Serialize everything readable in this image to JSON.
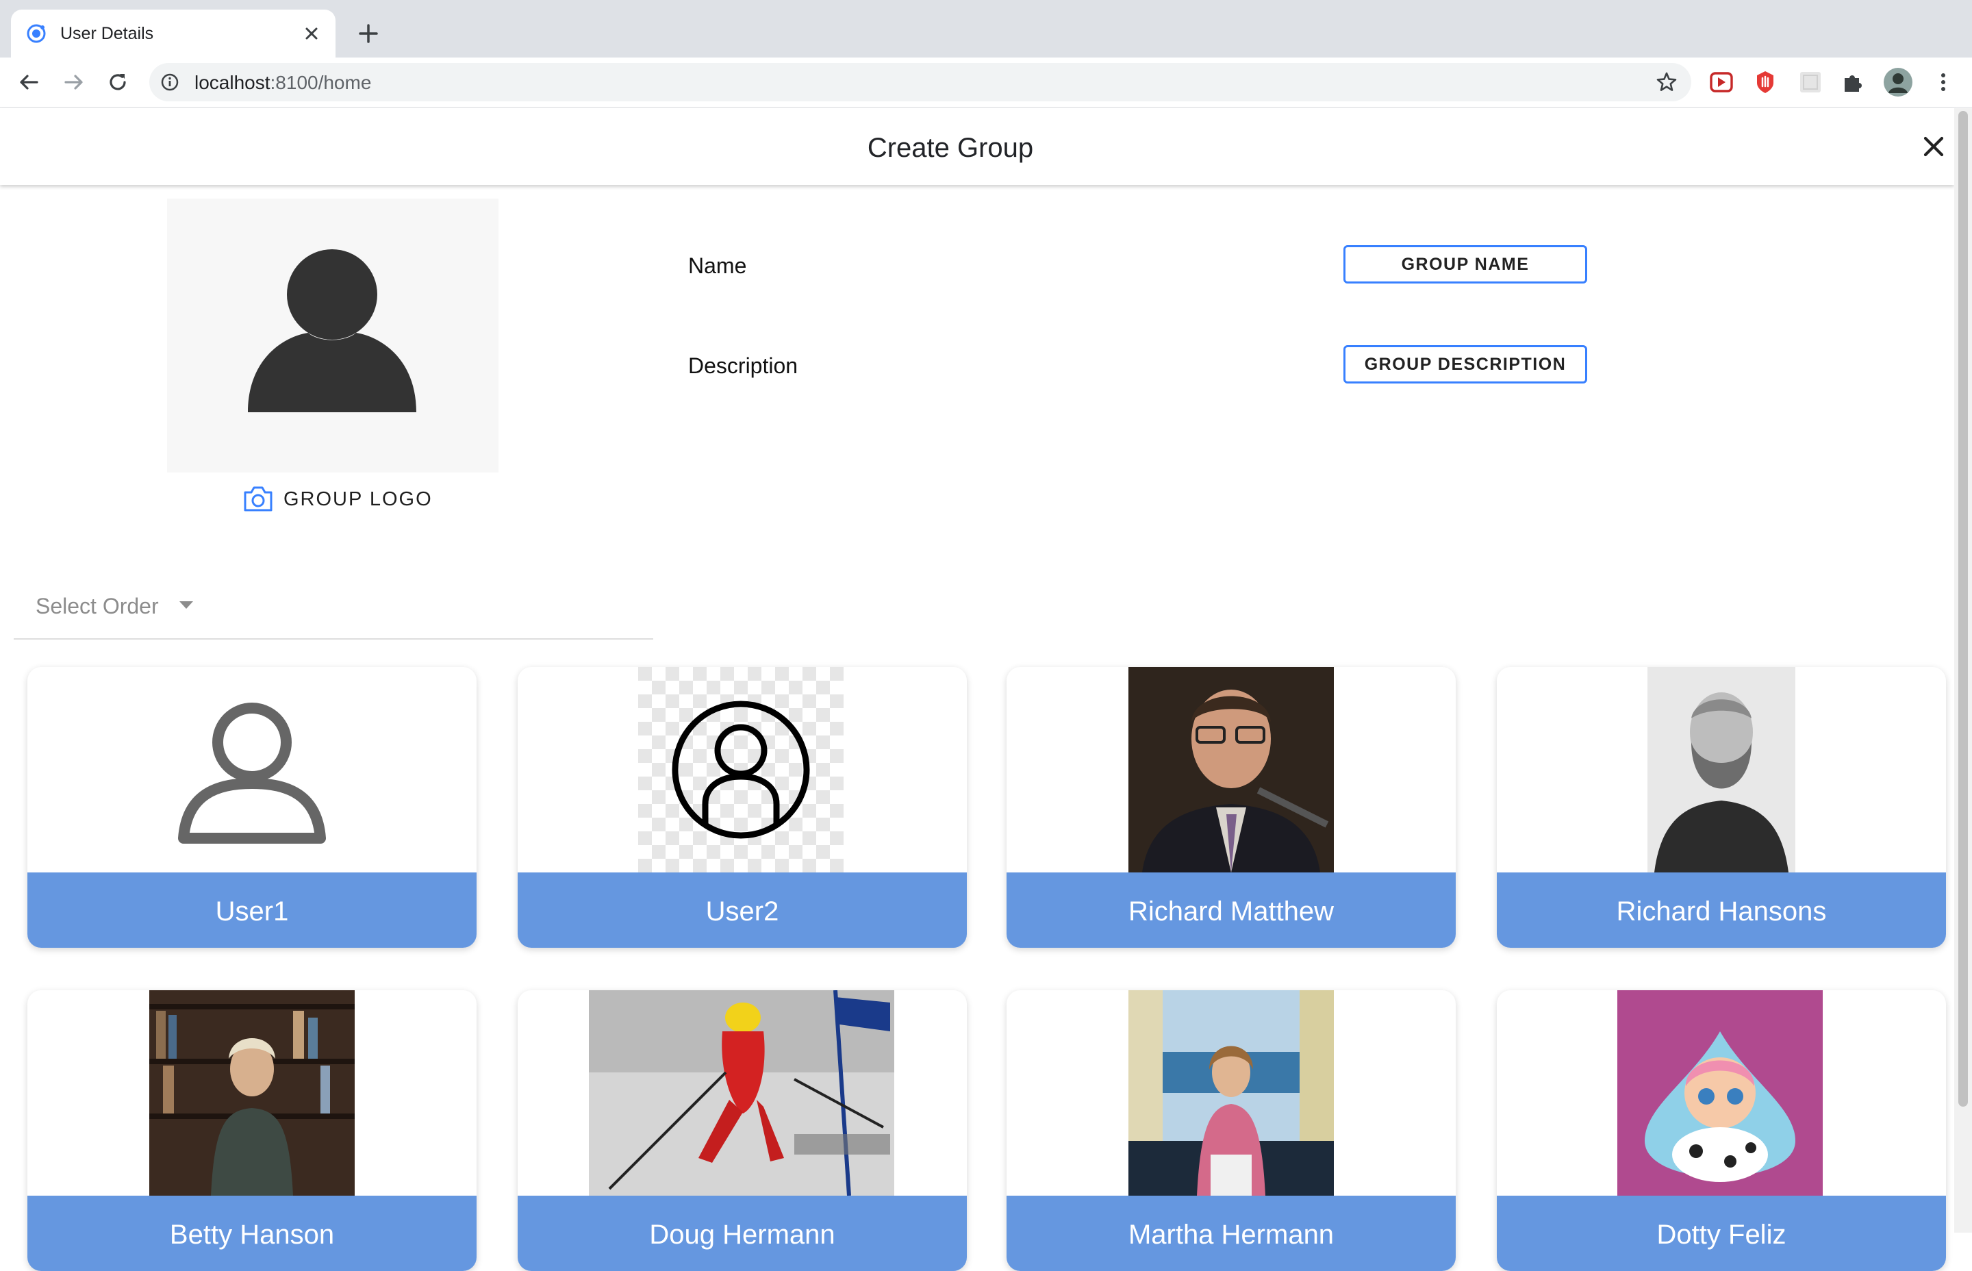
{
  "browser": {
    "tab_title": "User Details",
    "url_host": "localhost",
    "url_rest": ":8100/home"
  },
  "modal": {
    "title": "Create Group"
  },
  "form": {
    "logo_label": "GROUP LOGO",
    "name_label": "Name",
    "name_button": "GROUP NAME",
    "description_label": "Description",
    "description_button": "GROUP DESCRIPTION",
    "select_order_placeholder": "Select Order"
  },
  "users": [
    {
      "name": "User1",
      "image": "person-outline-icon"
    },
    {
      "name": "User2",
      "image": "person-circle-icon"
    },
    {
      "name": "Richard Matthew",
      "image": "man-with-glasses-photo"
    },
    {
      "name": "Richard Hansons",
      "image": "bearded-man-portrait-photo"
    },
    {
      "name": "Betty Hanson",
      "image": "woman-bookshelf-photo"
    },
    {
      "name": "Doug Hermann",
      "image": "skier-photo"
    },
    {
      "name": "Martha Hermann",
      "image": "woman-balcony-photo"
    },
    {
      "name": "Dotty Feliz",
      "image": "dotty-cartoon-image"
    }
  ],
  "colors": {
    "accent": "#3880ff",
    "card_label_bg": "#6597e0"
  }
}
